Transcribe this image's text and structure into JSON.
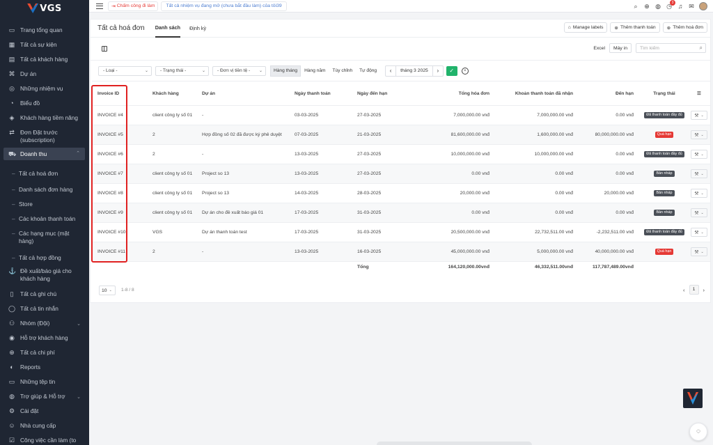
{
  "brand": {
    "name": "VGS"
  },
  "sidebar": {
    "items": [
      {
        "label": "Trang tổng quan",
        "icon": "monitor-icon"
      },
      {
        "label": "Tất cả sự kiện",
        "icon": "calendar-icon"
      },
      {
        "label": "Tất cả khách hàng",
        "icon": "briefcase-icon"
      },
      {
        "label": "Dự án",
        "icon": "command-icon"
      },
      {
        "label": "Những nhiệm vụ",
        "icon": "check-circle-icon"
      },
      {
        "label": "Biểu đồ",
        "icon": "pie-chart-icon"
      },
      {
        "label": "Khách hàng tiềm năng",
        "icon": "layers-icon"
      },
      {
        "label": "Đơn Đặt trước (subscription)",
        "icon": "repeat-icon"
      },
      {
        "label": "Doanh thu",
        "icon": "cart-icon"
      }
    ],
    "subitems": [
      "Tất cả hoá đơn",
      "Danh sách đơn hàng",
      "Store",
      "Các khoản thanh toán",
      "Các hạng mục (mặt hàng)",
      "Tất cả hợp đồng"
    ],
    "items2": [
      {
        "label": "Đề xuất/báo giá cho khách hàng",
        "icon": "anchor-icon"
      },
      {
        "label": "Tất cả ghi chú",
        "icon": "book-icon"
      },
      {
        "label": "Tất cả tin nhắn",
        "icon": "message-icon"
      },
      {
        "label": "Nhóm (Đội)",
        "icon": "users-icon"
      },
      {
        "label": "Hỗ trợ khách hàng",
        "icon": "life-buoy-icon"
      },
      {
        "label": "Tất cả chi phí",
        "icon": "plus-circle-icon"
      },
      {
        "label": "Reports",
        "icon": "gauge-icon"
      },
      {
        "label": "Những tệp tin",
        "icon": "folder-icon"
      },
      {
        "label": "Trợ giúp & Hỗ trợ",
        "icon": "help-icon"
      },
      {
        "label": "Cài đặt",
        "icon": "settings-icon"
      },
      {
        "label": "Nhà cung cấp",
        "icon": "user-icon"
      },
      {
        "label": "Công việc cần làm (to",
        "icon": "check-square-icon"
      }
    ]
  },
  "topbar": {
    "clock_in": "Chấm công đi làm",
    "task_notice": "Tất cả nhiệm vụ đang mở (chưa bắt đầu làm) của tôi39",
    "notification_count": "3"
  },
  "page": {
    "title": "Tất cả hoá đơn",
    "tabs": [
      "Danh sách",
      "Định kỳ"
    ],
    "buttons": {
      "labels": "Manage labels",
      "add_payment": "Thêm thanh toán",
      "add_invoice": "Thêm hoá đơn"
    },
    "excel": "Excel",
    "print": "Máy in",
    "search_placeholder": "Tìm kiếm"
  },
  "filters": {
    "type": "- Loại -",
    "status": "- Trạng thái -",
    "currency": "- Đơn vị tiền tệ -",
    "periods": [
      "Hàng tháng",
      "Hàng năm",
      "Tùy chỉnh",
      "Tự động"
    ],
    "current_period": "tháng 3 2025"
  },
  "table": {
    "headers": {
      "id": "Invoice ID",
      "client": "Khách hàng",
      "project": "Dự án",
      "bill_date": "Ngày thanh toán",
      "due_date": "Ngày đến hạn",
      "total": "Tổng hóa đơn",
      "paid": "Khoản thanh toán đã nhận",
      "due": "Đến hạn",
      "status": "Trạng thái"
    },
    "rows": [
      {
        "id": "INVOICE #4",
        "client": "client công ty số 01",
        "project": "-",
        "bill_date": "03-03-2025",
        "due_date": "27-03-2025",
        "total": "7,000,000.00 vnđ",
        "paid": "7,000,000.00 vnđ",
        "due": "0.00 vnđ",
        "status": "Đã thanh toán đầy đủ",
        "status_color": "#4a4f57"
      },
      {
        "id": "INVOICE #5",
        "client": "2",
        "project": "Hợp đồng số 02 đã được ký phê duyệt",
        "bill_date": "07-03-2025",
        "due_date": "21-03-2025",
        "total": "81,600,000.00 vnđ",
        "paid": "1,600,000.00 vnđ",
        "due": "80,000,000.00 vnđ",
        "status": "Quá hạn",
        "status_color": "#e53935"
      },
      {
        "id": "INVOICE #6",
        "client": "2",
        "project": "-",
        "bill_date": "13-03-2025",
        "due_date": "27-03-2025",
        "total": "10,000,000.00 vnđ",
        "paid": "10,000,000.00 vnđ",
        "due": "0.00 vnđ",
        "status": "Đã thanh toán đầy đủ",
        "status_color": "#4a4f57"
      },
      {
        "id": "INVOICE #7",
        "client": "client công ty số 01",
        "project": "Project so 13",
        "bill_date": "13-03-2025",
        "due_date": "27-03-2025",
        "total": "0.00 vnđ",
        "paid": "0.00 vnđ",
        "due": "0.00 vnđ",
        "status": "Bản nháp",
        "status_color": "#4a4f57"
      },
      {
        "id": "INVOICE #8",
        "client": "client công ty số 01",
        "project": "Project so 13",
        "bill_date": "14-03-2025",
        "due_date": "28-03-2025",
        "total": "20,000.00 vnđ",
        "paid": "0.00 vnđ",
        "due": "20,000.00 vnđ",
        "status": "Bản nháp",
        "status_color": "#4a4f57"
      },
      {
        "id": "INVOICE #9",
        "client": "client công ty số 01",
        "project": "Dự án cho đề xuất báo giá 01",
        "bill_date": "17-03-2025",
        "due_date": "31-03-2025",
        "total": "0.00 vnđ",
        "paid": "0.00 vnđ",
        "due": "0.00 vnđ",
        "status": "Bản nháp",
        "status_color": "#4a4f57"
      },
      {
        "id": "INVOICE #10",
        "client": "VGS",
        "project": "Dự án thanh toán test",
        "bill_date": "17-03-2025",
        "due_date": "31-03-2025",
        "total": "20,500,000.00 vnđ",
        "paid": "22,732,511.00 vnđ",
        "due": "-2,232,511.00 vnđ",
        "status": "Đã thanh toán đầy đủ",
        "status_color": "#4a4f57"
      },
      {
        "id": "INVOICE #11",
        "client": "2",
        "project": "-",
        "bill_date": "13-03-2025",
        "due_date": "16-03-2025",
        "total": "45,000,000.00 vnđ",
        "paid": "5,000,000.00 vnđ",
        "due": "40,000,000.00 vnđ",
        "status": "Quá hạn",
        "status_color": "#e53935"
      }
    ],
    "totals": {
      "label": "Tổng",
      "total": "164,120,000.00vnđ",
      "paid": "46,332,511.00vnđ",
      "due": "117,787,489.00vnđ"
    }
  },
  "footer": {
    "page_size": "10",
    "range": "1-8 / 8",
    "current_page": "1"
  }
}
